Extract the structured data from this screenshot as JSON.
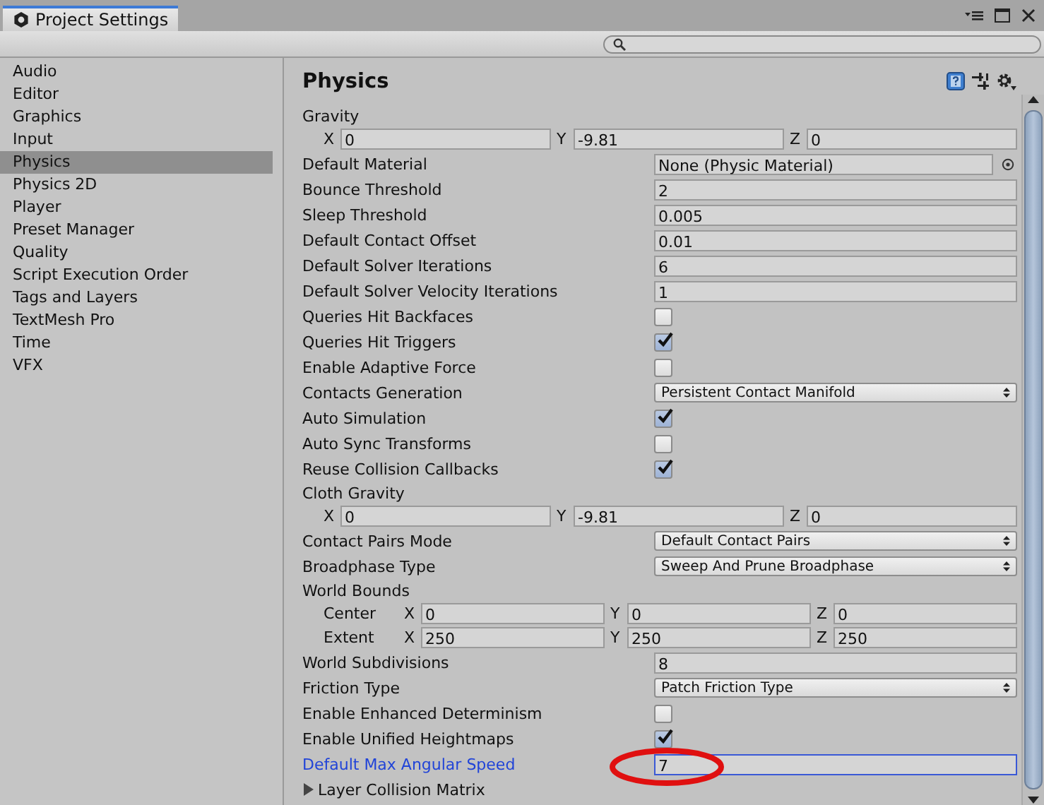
{
  "tab": {
    "title": "Project Settings"
  },
  "sidebar": {
    "items": [
      {
        "label": "Audio",
        "selected": false
      },
      {
        "label": "Editor",
        "selected": false
      },
      {
        "label": "Graphics",
        "selected": false
      },
      {
        "label": "Input",
        "selected": false
      },
      {
        "label": "Physics",
        "selected": true
      },
      {
        "label": "Physics 2D",
        "selected": false
      },
      {
        "label": "Player",
        "selected": false
      },
      {
        "label": "Preset Manager",
        "selected": false
      },
      {
        "label": "Quality",
        "selected": false
      },
      {
        "label": "Script Execution Order",
        "selected": false
      },
      {
        "label": "Tags and Layers",
        "selected": false
      },
      {
        "label": "TextMesh Pro",
        "selected": false
      },
      {
        "label": "Time",
        "selected": false
      },
      {
        "label": "VFX",
        "selected": false
      }
    ]
  },
  "panel": {
    "title": "Physics",
    "rows": [
      {
        "kind": "vector",
        "label": "Gravity",
        "fields": [
          {
            "axis": "X",
            "value": "0"
          },
          {
            "axis": "Y",
            "value": "-9.81"
          },
          {
            "axis": "Z",
            "value": "0"
          }
        ]
      },
      {
        "kind": "object",
        "label": "Default Material",
        "value": "None (Physic Material)"
      },
      {
        "kind": "text",
        "label": "Bounce Threshold",
        "value": "2"
      },
      {
        "kind": "text",
        "label": "Sleep Threshold",
        "value": "0.005"
      },
      {
        "kind": "text",
        "label": "Default Contact Offset",
        "value": "0.01"
      },
      {
        "kind": "text",
        "label": "Default Solver Iterations",
        "value": "6"
      },
      {
        "kind": "text",
        "label": "Default Solver Velocity Iterations",
        "value": "1"
      },
      {
        "kind": "checkbox",
        "label": "Queries Hit Backfaces",
        "checked": false
      },
      {
        "kind": "checkbox",
        "label": "Queries Hit Triggers",
        "checked": true
      },
      {
        "kind": "checkbox",
        "label": "Enable Adaptive Force",
        "checked": false
      },
      {
        "kind": "dropdown",
        "label": "Contacts Generation",
        "value": "Persistent Contact Manifold"
      },
      {
        "kind": "checkbox",
        "label": "Auto Simulation",
        "checked": true
      },
      {
        "kind": "checkbox",
        "label": "Auto Sync Transforms",
        "checked": false
      },
      {
        "kind": "checkbox",
        "label": "Reuse Collision Callbacks",
        "checked": true
      },
      {
        "kind": "vector",
        "label": "Cloth Gravity",
        "fields": [
          {
            "axis": "X",
            "value": "0"
          },
          {
            "axis": "Y",
            "value": "-9.81"
          },
          {
            "axis": "Z",
            "value": "0"
          }
        ]
      },
      {
        "kind": "dropdown",
        "label": "Contact Pairs Mode",
        "value": "Default Contact Pairs"
      },
      {
        "kind": "dropdown",
        "label": "Broadphase Type",
        "value": "Sweep And Prune Broadphase"
      },
      {
        "kind": "bounds",
        "label": "World Bounds",
        "rows": [
          {
            "label": "Center",
            "fields": [
              {
                "axis": "X",
                "value": "0"
              },
              {
                "axis": "Y",
                "value": "0"
              },
              {
                "axis": "Z",
                "value": "0"
              }
            ]
          },
          {
            "label": "Extent",
            "fields": [
              {
                "axis": "X",
                "value": "250"
              },
              {
                "axis": "Y",
                "value": "250"
              },
              {
                "axis": "Z",
                "value": "250"
              }
            ]
          }
        ]
      },
      {
        "kind": "text",
        "label": "World Subdivisions",
        "value": "8"
      },
      {
        "kind": "dropdown",
        "label": "Friction Type",
        "value": "Patch Friction Type"
      },
      {
        "kind": "checkbox",
        "label": "Enable Enhanced Determinism",
        "checked": false
      },
      {
        "kind": "checkbox",
        "label": "Enable Unified Heightmaps",
        "checked": true
      },
      {
        "kind": "text",
        "label": "Default Max Angular Speed",
        "value": "7",
        "focused": true,
        "circled": true
      }
    ],
    "section": {
      "label": "Layer Collision Matrix",
      "expanded": false
    }
  }
}
